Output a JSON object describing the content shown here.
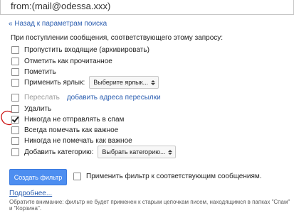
{
  "search": {
    "query": "from:(mail@odessa.xxx)"
  },
  "back_link": "« Назад к параметрам поиска",
  "intro": "При поступлении сообщения, соответствующего этому запросу:",
  "options": {
    "skip_inbox": {
      "label": "Пропустить входящие (архивировать)",
      "checked": false
    },
    "mark_read": {
      "label": "Отметить как прочитанное",
      "checked": false
    },
    "star": {
      "label": "Пометить",
      "checked": false
    },
    "apply_label": {
      "label": "Применить ярлык:",
      "checked": false,
      "select": "Выберите ярлык..."
    },
    "forward": {
      "label": "Переслать",
      "checked": false,
      "link": "добавить адреса пересылки"
    },
    "delete": {
      "label": "Удалить",
      "checked": false
    },
    "never_spam": {
      "label": "Никогда не отправлять в спам",
      "checked": true
    },
    "always_important": {
      "label": "Всегда помечать как важное",
      "checked": false
    },
    "never_important": {
      "label": "Никогда не помечать как важное",
      "checked": false
    },
    "category": {
      "label": "Добавить категорию:",
      "checked": false,
      "select": "Выбрать категорию..."
    }
  },
  "create_button": "Создать фильтр",
  "apply_existing": {
    "label": "Применить фильтр к соответствующим сообщениям.",
    "checked": false
  },
  "more_link": "Подробнее...",
  "note": "Обратите внимание: фильтр не будет применен к старым цепочкам писем, находящимся в папках \"Спам\" и \"Корзина\".",
  "colors": {
    "link": "#2a5db0",
    "button": "#4d8ef0",
    "annotation": "#cc1111"
  }
}
